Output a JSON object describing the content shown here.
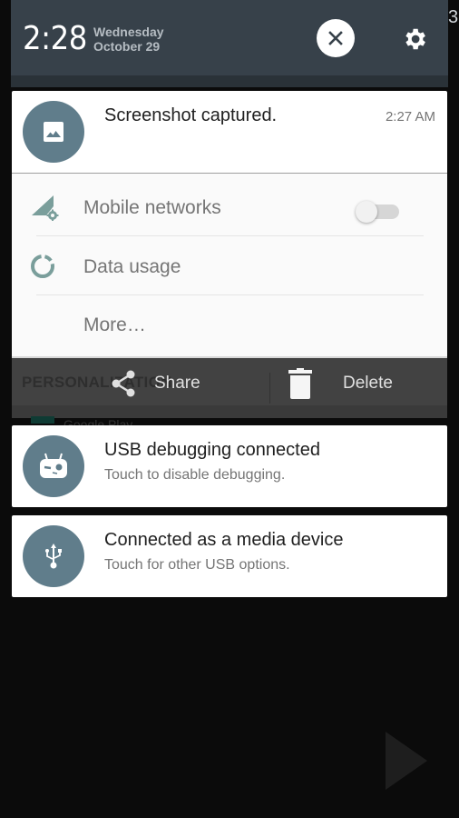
{
  "header": {
    "time": "2:28",
    "day": "Wednesday",
    "date": "October 29",
    "clear_icon": "close-icon",
    "settings_icon": "gear-icon"
  },
  "notifications": [
    {
      "icon": "image-icon",
      "title": "Screenshot captured.",
      "time": "2:27 AM",
      "actions": [
        {
          "label": "Share",
          "icon": "share-icon"
        },
        {
          "label": "Delete",
          "icon": "trash-icon"
        }
      ]
    },
    {
      "icon": "cyanogenmod-bugdroid-icon",
      "title": "USB debugging connected",
      "text": "Touch to disable debugging."
    },
    {
      "icon": "usb-icon",
      "title": "Connected as a media device",
      "text": "Touch for other USB options."
    }
  ],
  "background_settings": {
    "items": [
      {
        "label": "Mobile networks",
        "icon": "signal-settings-icon",
        "toggle": false
      },
      {
        "label": "Data usage",
        "icon": "data-usage-icon"
      },
      {
        "label": "More…"
      }
    ],
    "section_header": "PERSONALIZATION",
    "partial_item": "Google Play"
  },
  "colors": {
    "header_bg": "#37414a",
    "avatar_bg": "#607d8b",
    "settings_icon": "#7a9e9b",
    "action_bar_bg": "#424242"
  }
}
